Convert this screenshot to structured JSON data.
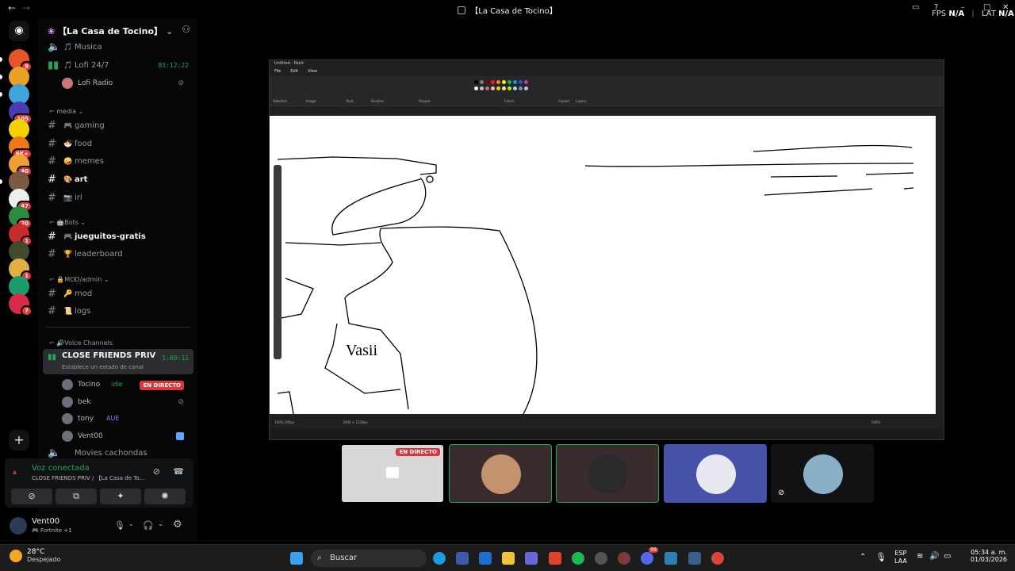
{
  "titlebar": {
    "back": "←",
    "forward": "→",
    "title": "【La Casa de Tocino】",
    "fps_label": "FPS",
    "fps_value": "N/A",
    "lat_label": "LAT",
    "lat_value": "N/A"
  },
  "servers": [
    {
      "color": "#e8542a",
      "badge": "9"
    },
    {
      "color": "#e7a125",
      "badge": ""
    },
    {
      "color": "#3fa4d9",
      "badge": ""
    },
    {
      "color": "#4a3bb5",
      "badge": "105"
    },
    {
      "color": "#f5d000",
      "badge": ""
    },
    {
      "color": "#f07a1a",
      "badge": "6K+"
    },
    {
      "color": "#f0a030",
      "badge": "40"
    },
    {
      "color": "#7a5a45",
      "badge": ""
    },
    {
      "color": "#eeeeee",
      "badge": "47"
    },
    {
      "color": "#2b8c3e",
      "badge": "20"
    },
    {
      "color": "#c62c2c",
      "badge": "1"
    },
    {
      "color": "#3f4a2f",
      "badge": ""
    },
    {
      "color": "#e0b040",
      "badge": "1"
    },
    {
      "color": "#1b9c6a",
      "badge": ""
    },
    {
      "color": "#d82a4a",
      "badge": "7"
    }
  ],
  "guild": {
    "name": "【La Casa de Tocino】"
  },
  "channels": {
    "musica": {
      "emoji": "🎵",
      "name": "Musica"
    },
    "lofi": {
      "emoji": "🎵",
      "name": "Lofi 24/7",
      "time": "83:12:22"
    },
    "lofi_user": "Lofi Radio",
    "cat_media": "media",
    "gaming": {
      "emoji": "🎮",
      "name": "gaming"
    },
    "food": {
      "emoji": "🍜",
      "name": "food"
    },
    "memes": {
      "emoji": "🤪",
      "name": "memes"
    },
    "art": {
      "emoji": "🎨",
      "name": "art"
    },
    "irl": {
      "emoji": "📷",
      "name": "irl"
    },
    "cat_bots": "Bots",
    "jueguitos": {
      "emoji": "🎮",
      "name": "jueguitos-gratis"
    },
    "leaderboard": {
      "emoji": "🏆",
      "name": "leaderboard"
    },
    "cat_mod": "MOD/admin",
    "mod": {
      "emoji": "🔑",
      "name": "mod"
    },
    "logs": {
      "emoji": "📜",
      "name": "logs"
    },
    "cat_voice": "Voice Channels",
    "close_friends": {
      "name": "CLOSE FRIENDS PRIV",
      "time": "1:00:11",
      "status": "Establece un estado de canal"
    },
    "movies": "Movies cachondas"
  },
  "voice_users": [
    {
      "name": "Tocino",
      "status": "idle",
      "live": "EN DIRECTO"
    },
    {
      "name": "bek",
      "status": "",
      "live": ""
    },
    {
      "name": "tony",
      "status": "AUE",
      "live": ""
    },
    {
      "name": "Vent00",
      "status": "",
      "live": ""
    }
  ],
  "voice_panel": {
    "connected": "Voz conectada",
    "path": "CLOSE FRIENDS PRIV / 【La Casa de To..."
  },
  "user": {
    "name": "Vent00",
    "activity": "Fortnite +1"
  },
  "paint": {
    "title": "Untitled - Paint",
    "menu": [
      "File",
      "Edit",
      "View"
    ],
    "ribbon_labels": [
      "Selection",
      "Image",
      "Tools",
      "Brushes",
      "Shapes",
      "Colors",
      "Copilot",
      "Layers"
    ],
    "handwriting": "Vasii",
    "status_left": "100%  100px",
    "status_mid": "2944 × 1228px",
    "zoom": "100%",
    "palette": [
      "#000000",
      "#7f7f7f",
      "#880015",
      "#ed1c24",
      "#ff7f27",
      "#fff200",
      "#22b14c",
      "#00a2e8",
      "#3f48cc",
      "#a349a4",
      "#ffffff",
      "#c3c3c3",
      "#b97a57",
      "#ffaec9",
      "#ffc90e",
      "#efe4b0",
      "#b5e61d",
      "#99d9ea",
      "#7092be",
      "#c8bfe7"
    ]
  },
  "tiles": [
    {
      "label": "EN DIRECTO",
      "bg": "#8a8a8a",
      "border": "#000000"
    },
    {
      "bg": "#3a2c2c",
      "border": "#23a55a",
      "circle": "#c4926e"
    },
    {
      "bg": "#3a2c2c",
      "border": "#23a55a",
      "circle": "#2a2a2a"
    },
    {
      "bg": "#4552a8",
      "border": "#4552a8",
      "circle": "#e8e8f0"
    },
    {
      "bg": "#111214",
      "border": "#111214",
      "circle": "#8ab0c8"
    }
  ],
  "taskbar": {
    "temp": "28°C",
    "weather": "Despejado",
    "search": "Buscar",
    "lang1": "ESP",
    "lang2": "LAA",
    "time": "05:34 a. m.",
    "date": "01/03/2026",
    "badge": "99"
  }
}
